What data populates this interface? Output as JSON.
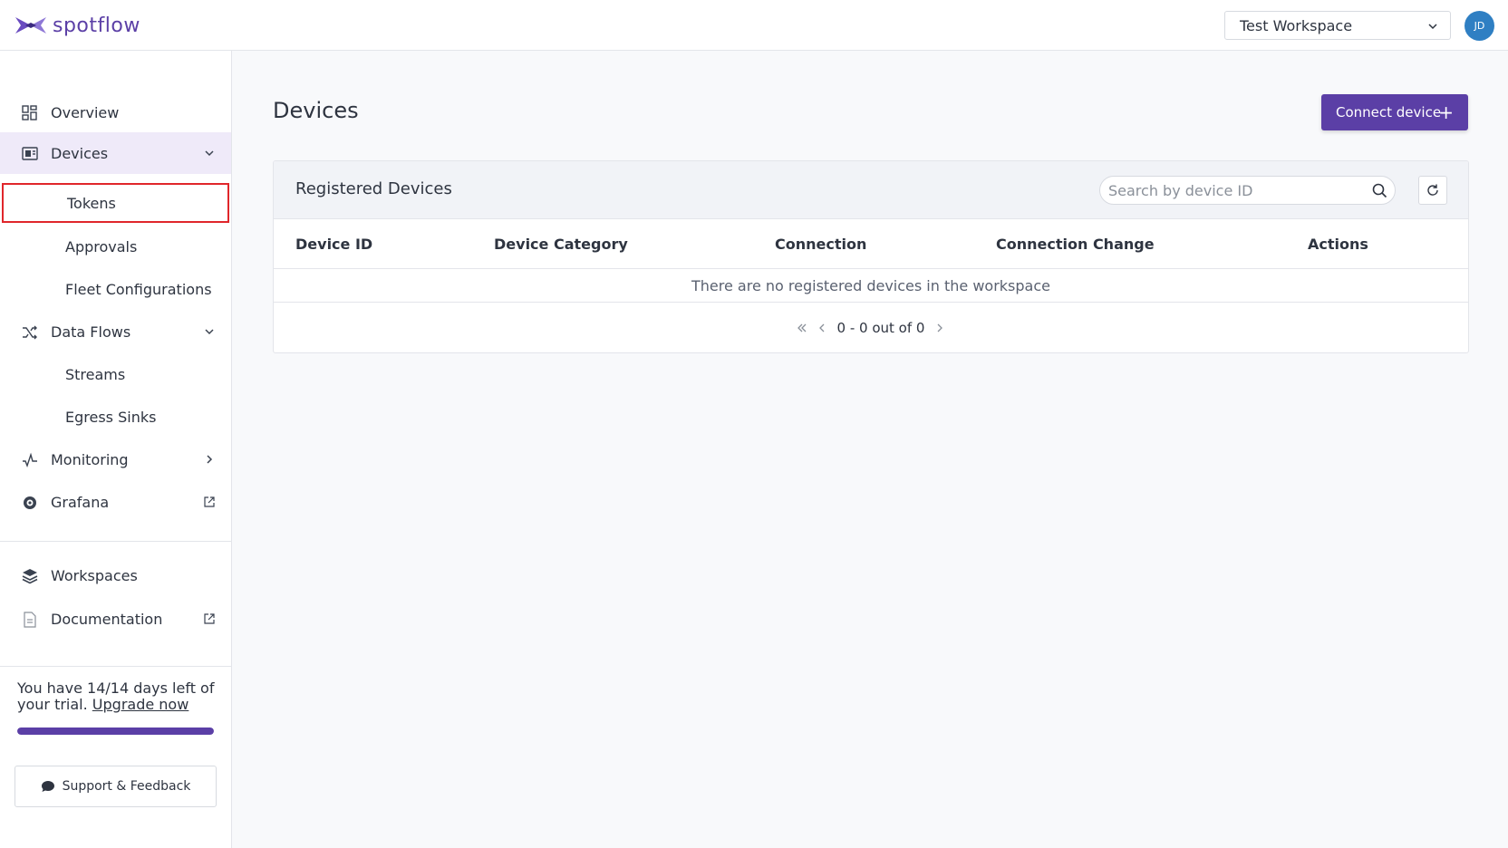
{
  "app": {
    "logo_text": "spotflow",
    "workspace_select": "Test Workspace",
    "avatar_initials": "JD",
    "brand_color": "#5b3fa6"
  },
  "sidebar": {
    "items": [
      {
        "label": "Overview",
        "icon": "grid-icon"
      },
      {
        "label": "Devices",
        "icon": "device-icon",
        "active": true
      },
      {
        "label": "Tokens",
        "sub": true,
        "highlight": true
      },
      {
        "label": "Approvals",
        "sub": true
      },
      {
        "label": "Fleet Configurations",
        "sub": true
      },
      {
        "label": "Data Flows",
        "icon": "shuffle-icon"
      },
      {
        "label": "Streams",
        "sub": true
      },
      {
        "label": "Egress Sinks",
        "sub": true
      },
      {
        "label": "Monitoring",
        "icon": "pulse-icon"
      },
      {
        "label": "Grafana",
        "icon": "grafana-icon"
      },
      {
        "label": "Workspaces",
        "icon": "layers-icon"
      },
      {
        "label": "Documentation",
        "icon": "document-icon"
      }
    ],
    "trial": {
      "text": "You have 14/14 days left of your trial.",
      "link": "Upgrade now",
      "progress": 1.0
    },
    "support_label": "Support & Feedback"
  },
  "main": {
    "title": "Devices",
    "connect_label": "Connect device",
    "card": {
      "title": "Registered Devices",
      "search_placeholder": "Search by device ID",
      "columns": [
        "Device ID",
        "Device Category",
        "Connection",
        "Connection Change",
        "Actions"
      ],
      "empty_text": "There are no registered devices in the workspace",
      "pagination": "0 - 0 out of 0"
    }
  }
}
